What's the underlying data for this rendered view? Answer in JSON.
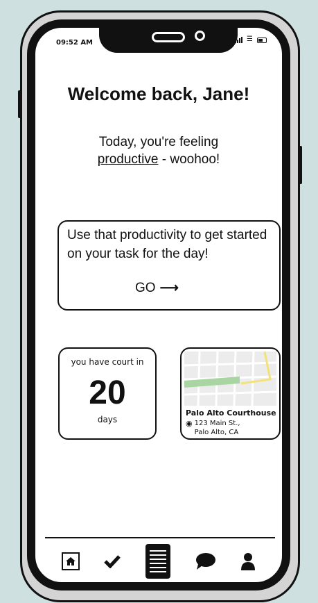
{
  "status_bar": {
    "time": "09:52 AM"
  },
  "welcome": {
    "title": "Welcome back, Jane!"
  },
  "mood": {
    "line1": "Today, you're feeling",
    "mood_word": "productive",
    "line2_rest": " - woohoo!"
  },
  "task_card": {
    "text": "Use that productivity to get started on your task for the day!",
    "go_label": "GO"
  },
  "court_card": {
    "prefix": "you have court in",
    "number": "20",
    "unit": "days"
  },
  "location_card": {
    "name": "Palo Alto Courthouse",
    "address_line1": "123 Main St.,",
    "address_line2": "Palo Alto, CA"
  },
  "nav": {
    "items": [
      "home",
      "tasks",
      "documents",
      "messages",
      "profile"
    ],
    "active": "documents"
  },
  "icons": {
    "home": "home-icon",
    "tasks": "checkmark-icon",
    "documents": "document-icon",
    "messages": "chat-bubble-icon",
    "profile": "user-icon",
    "location": "map-pin-icon"
  },
  "colors": {
    "background": "#cfe0e0",
    "screen": "#ffffff",
    "ink": "#111111",
    "map_green": "#a8d5a2",
    "map_yellow": "#f3e27a"
  }
}
